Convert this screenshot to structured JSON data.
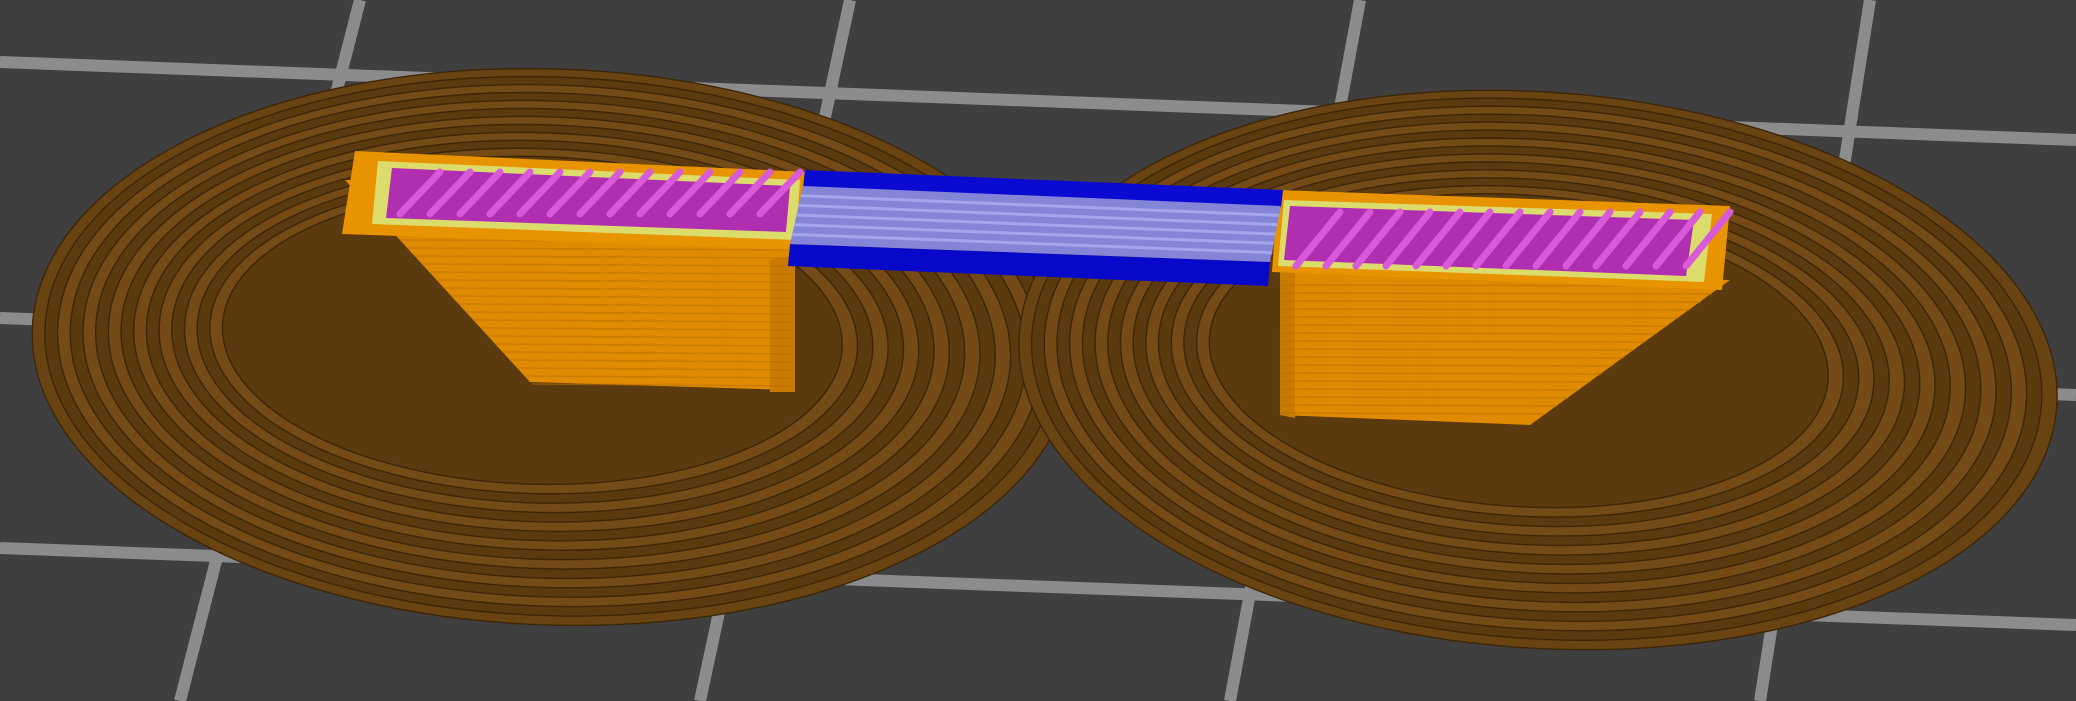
{
  "viewport": {
    "scene": "slicer-layer-preview",
    "background_color": "#3f3f40",
    "bed_grid_color": "#a9a9a9",
    "legend": []
  },
  "colors": {
    "skirt_brim": "#6a4313",
    "skirt_brim_dark": "#3f2608",
    "skirt_brim_light": "#8a5a1e",
    "external_perimeter": "#e08a00",
    "external_perimeter_dark": "#a86400",
    "perimeter": "#f0a600",
    "inner_perimeter": "#e0e070",
    "infill": "#b32fb3",
    "infill_light": "#d04ad0",
    "bridge_outer": "#0a0acc",
    "bridge_infill": "#8a8adc",
    "bridge_infill_light": "#a8a8ee"
  }
}
